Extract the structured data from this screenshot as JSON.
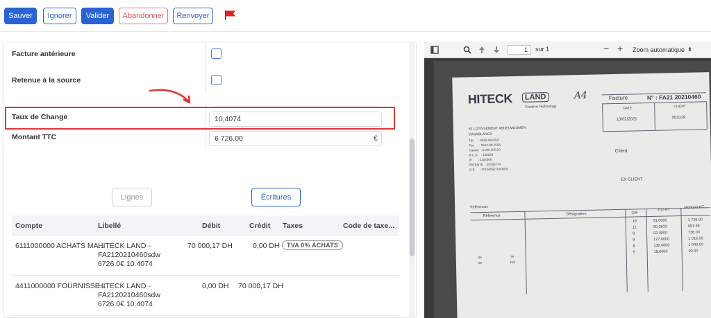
{
  "toolbar": {
    "save": "Sauver",
    "ignore": "Ignorer",
    "validate": "Valider",
    "abandon": "Abandonner",
    "resend": "Renvoyer",
    "flag_color": "#e02020"
  },
  "form": {
    "previous_invoice_label": "Facture antérieure",
    "withholding_label": "Retenue à la source",
    "exchange_rate_label": "Taux de Change",
    "exchange_rate_value": "10,4074",
    "total_ttc_label": "Montant TTC",
    "total_ttc_value": "6 726,00",
    "currency_symbol": "€"
  },
  "tabs": {
    "lines": "Lignes",
    "entries": "Écritures"
  },
  "table": {
    "headers": [
      "Compte",
      "Libellé",
      "Débit",
      "Crédit",
      "Taxes",
      "Code de taxe..."
    ],
    "rows": [
      {
        "account": "6111000000 ACHATS MA...",
        "label1": "HITECK LAND -",
        "label2": "FA2120210460sdw",
        "label3": "6726.0€ 10.4074",
        "debit": "70 000,17 DH",
        "credit": "0,00 DH",
        "tax": "TVA 0% ACHATS"
      },
      {
        "account": "4411000000 FOURNISSE...",
        "label1": "HITECK LAND -",
        "label2": "FA2120210460sdw",
        "label3": "6726.0€ 10.4074",
        "debit": "0,00 DH",
        "credit": "70 000,17 DH",
        "tax": ""
      }
    ]
  },
  "viewer": {
    "page": "1",
    "of_pages": "sur 1",
    "zoom": "Zoom automatique",
    "doc": {
      "brand": "HITECK",
      "brand_suffix": "LAND",
      "tagline": "Creative Technology",
      "handwritten": "A4",
      "invoice_label": "Facture",
      "invoice_number": "N° : FA21 20210460",
      "date_label": "DATE",
      "client_label": "CLIENT",
      "date_value": "13/02/2021",
      "client_value": "003119",
      "address": "83 LOTISSEMENT ABDELMOUMEN",
      "city": "CASABLANCA",
      "tel": "Tél      : 0522-98-0507",
      "fax": "Fax      : 0522-98-0508",
      "capital": "Capital  : 5.000.000,00",
      "rc": "R.C.S    : 158169",
      "if": "IF       : 1104566",
      "patente": "PATENTE  : 35780774",
      "ice": "ICE      : 001545527000009",
      "client_text": "Client",
      "ex_client": "EX CLIENT",
      "references": "Références",
      "col_ref": "Réference",
      "col_designation": "Désignation",
      "col_qty": "Qté",
      "col_pu": "P.U.HT",
      "col_amount": "Montant HT",
      "qty": [
        "19",
        "11",
        "8",
        "8",
        "8",
        "5"
      ],
      "pu": [
        "91.0000",
        "90.3633",
        "92.0000",
        "127.0000",
        "130.0000",
        "18.0000"
      ],
      "amounts": [
        "1 729.00",
        "993.99",
        "736.00",
        "1 016.00",
        "1 040.00",
        "90.00"
      ],
      "codes": [
        "06",
        "06"
      ],
      "codes2": [
        "TP",
        "PW"
      ]
    }
  }
}
